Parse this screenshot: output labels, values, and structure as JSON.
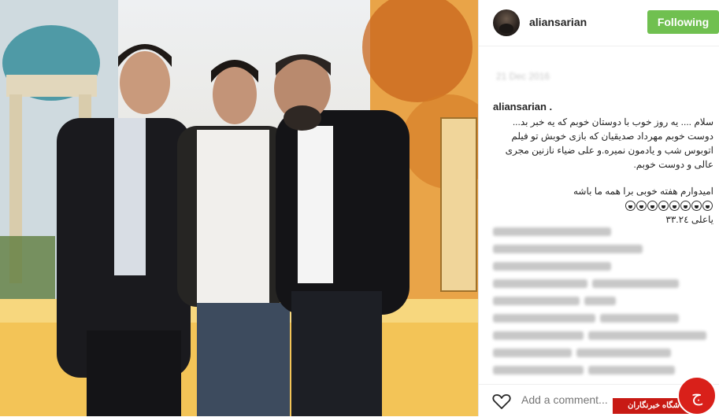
{
  "post": {
    "username": "aliansarian",
    "follow_label": "Following",
    "date_blurred": "21 Dec 2016",
    "caption_author": "aliansarian .",
    "caption_lines": [
      "سلام .... یه روز خوب با دوستان خوبم که یه خبر بد...",
      "دوست خوبم مهرداد صدیقیان که بازی خوبش تو فیلم",
      "اتوبوس شب و یادمون نمیره.و علی ضیاء نازنین مجری",
      "عالی و دوست خوبم."
    ],
    "caption_line2": "امیدوارم هفته خوبی برا همه ما باشه",
    "caption_line3": "یاعلی ۳۳.۲٤",
    "emoji_count": 8,
    "add_comment_placeholder": "Add a comment...",
    "watermark_text": "باشگاه خبرنگاران",
    "watermark_logo_glyph": "ج"
  },
  "icons": {
    "heart": "heart-icon",
    "avatar": "profile-avatar"
  },
  "colors": {
    "follow_button": "#70c050",
    "watermark_red": "#c81a14"
  }
}
